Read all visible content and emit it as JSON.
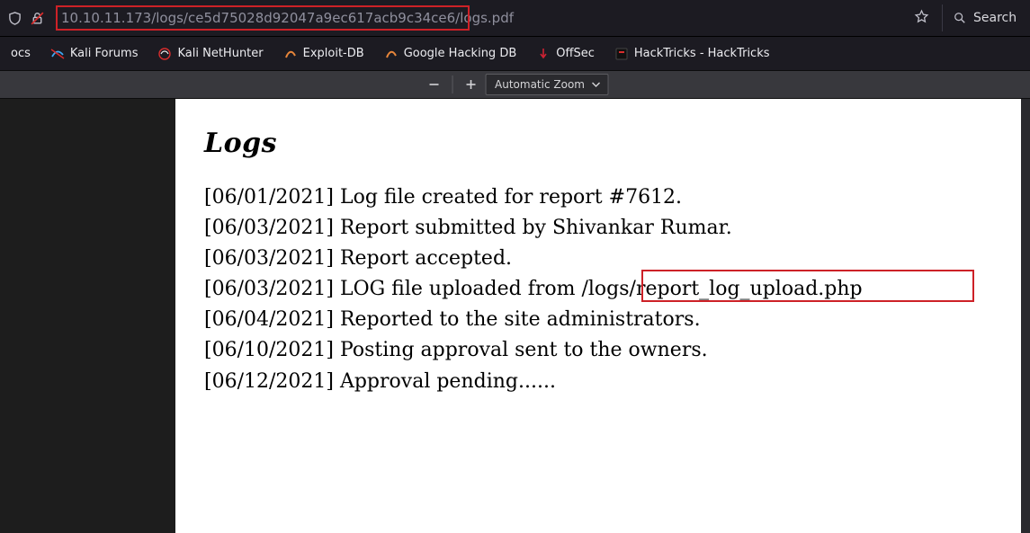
{
  "url_bar": {
    "url": "10.10.11.173/logs/ce5d75028d92047a9ec617acb9c34ce6/logs.pdf",
    "search_placeholder": "Search"
  },
  "bookmarks": [
    {
      "label": "ocs"
    },
    {
      "label": "Kali Forums"
    },
    {
      "label": "Kali NetHunter"
    },
    {
      "label": "Exploit-DB"
    },
    {
      "label": "Google Hacking DB"
    },
    {
      "label": "OffSec"
    },
    {
      "label": "HackTricks - HackTricks"
    }
  ],
  "pdf_toolbar": {
    "zoom_label": "Automatic Zoom"
  },
  "document": {
    "title": "Logs",
    "lines": [
      {
        "date": "[06/01/2021]",
        "text": " Log file created for report #7612."
      },
      {
        "date": "[06/03/2021]",
        "text": " Report submitted by Shivankar Rumar."
      },
      {
        "date": "[06/03/2021]",
        "text": " Report accepted."
      },
      {
        "date": "[06/03/2021]",
        "text": " LOG file uploaded from ",
        "path": "/logs/report_log_upload.php"
      },
      {
        "date": "[06/04/2021]",
        "text": " Reported to the site administrators."
      },
      {
        "date": "[06/10/2021]",
        "text": " Posting approval sent to the owners."
      },
      {
        "date": "[06/12/2021]",
        "text": " Approval pending......"
      }
    ]
  }
}
